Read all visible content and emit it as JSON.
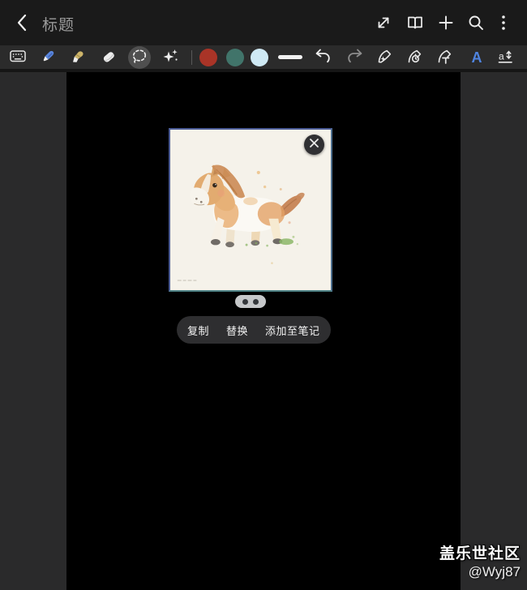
{
  "header": {
    "title": "标题",
    "back_icon": "chevron-left-icon",
    "action_icons": [
      "expand-diagonal-icon",
      "reader-view-book-icon",
      "plus-icon",
      "search-icon",
      "more-options-kebab-icon"
    ]
  },
  "toolbar": {
    "tool_icons": [
      "keyboard-icon",
      "pen-icon",
      "highlighter-icon",
      "eraser-icon",
      "lasso-selection-icon",
      "sparkle-effects-icon"
    ],
    "selected_tool": "lasso-selection",
    "colors": [
      "#a93427",
      "#41746a",
      "#cfe9f4"
    ],
    "stroke_preview": "thick-line",
    "undo_icon": "undo-arrow-icon",
    "redo_icon": "redo-arrow-icon",
    "pen_feature_icons": [
      "pen-beautify-sparkle-icon",
      "pen-timer-icon",
      "pen-to-text-icon",
      "letter-a-style-icon",
      "text-size-icon"
    ],
    "accent_blue": "#4f84e0",
    "letter_a_label": "A"
  },
  "canvas": {
    "selected_object": "watercolor-pony-image",
    "close_icon": "close-x-icon",
    "page_indicator_dots": 2
  },
  "menu": {
    "items": [
      {
        "label": "复制"
      },
      {
        "label": "替换"
      },
      {
        "label": "添加至笔记"
      }
    ]
  },
  "watermark": {
    "community": "盖乐世社区",
    "user": "@Wyj87"
  }
}
